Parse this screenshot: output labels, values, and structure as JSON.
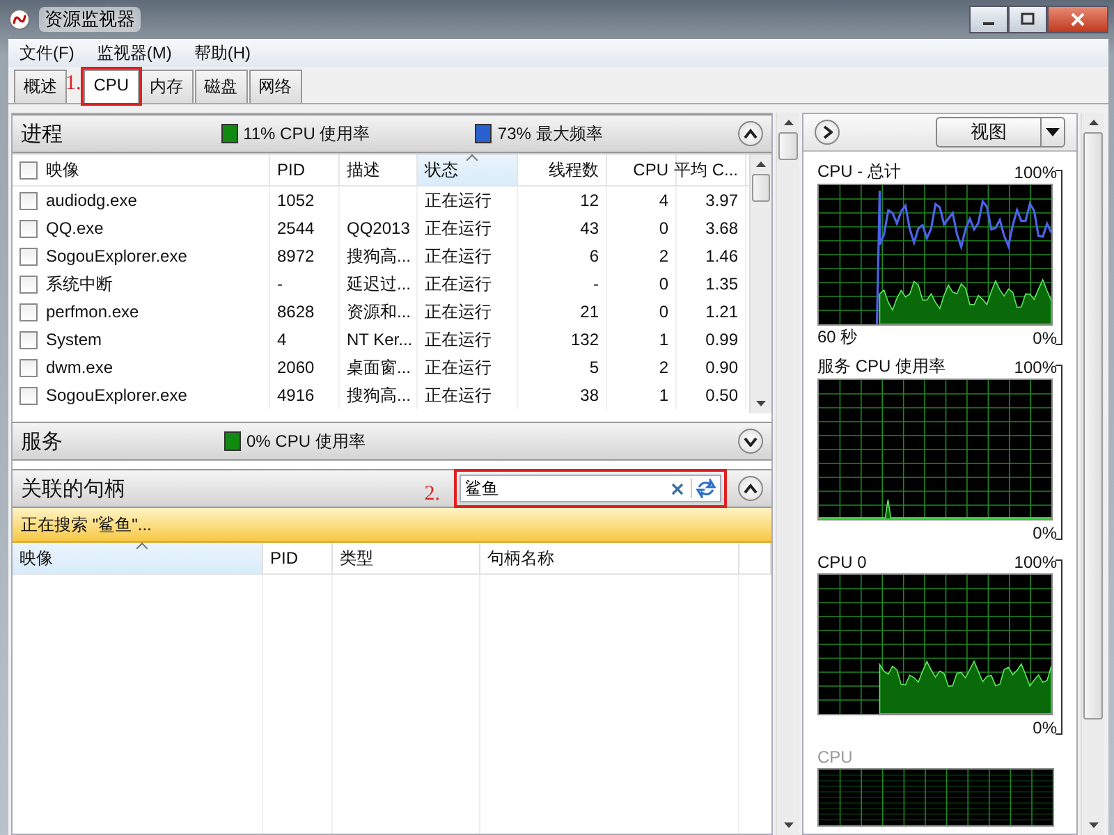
{
  "window": {
    "title": "资源监视器"
  },
  "menu": [
    "文件(F)",
    "监视器(M)",
    "帮助(H)"
  ],
  "tabs": [
    {
      "label": "概述",
      "selected": false,
      "marked": false
    },
    {
      "label": "CPU",
      "selected": true,
      "marked": true
    },
    {
      "label": "内存",
      "selected": false,
      "marked": false
    },
    {
      "label": "磁盘",
      "selected": false,
      "marked": false
    },
    {
      "label": "网络",
      "selected": false,
      "marked": false
    }
  ],
  "annotations": [
    "1.",
    "2."
  ],
  "processes": {
    "title": "进程",
    "expanded": true,
    "stats": [
      {
        "text": "11% CPU 使用率",
        "color": "#128a12"
      },
      {
        "text": "73% 最大频率",
        "color": "#2a5fd0"
      }
    ],
    "header_checked": false,
    "columns": [
      {
        "label": "映像",
        "sorted": false
      },
      {
        "label": "PID",
        "sorted": false
      },
      {
        "label": "描述",
        "sorted": false
      },
      {
        "label": "状态",
        "sorted": true
      },
      {
        "label": "线程数",
        "sorted": false
      },
      {
        "label": "CPU",
        "sorted": false
      },
      {
        "label": "平均 C...",
        "sorted": false
      }
    ],
    "rows": [
      {
        "checked": false,
        "cells": [
          "audiodg.exe",
          "1052",
          "",
          "正在运行",
          "12",
          "4",
          "3.97"
        ]
      },
      {
        "checked": false,
        "cells": [
          "QQ.exe",
          "2544",
          "QQ2013",
          "正在运行",
          "43",
          "0",
          "3.68"
        ]
      },
      {
        "checked": false,
        "cells": [
          "SogouExplorer.exe",
          "8972",
          "搜狗高...",
          "正在运行",
          "6",
          "2",
          "1.46"
        ]
      },
      {
        "checked": false,
        "cells": [
          "系统中断",
          "-",
          "延迟过...",
          "正在运行",
          "-",
          "0",
          "1.35"
        ]
      },
      {
        "checked": false,
        "cells": [
          "perfmon.exe",
          "8628",
          "资源和...",
          "正在运行",
          "21",
          "0",
          "1.21"
        ]
      },
      {
        "checked": false,
        "cells": [
          "System",
          "4",
          "NT Ker...",
          "正在运行",
          "132",
          "1",
          "0.99"
        ]
      },
      {
        "checked": false,
        "cells": [
          "dwm.exe",
          "2060",
          "桌面窗...",
          "正在运行",
          "5",
          "2",
          "0.90"
        ]
      },
      {
        "checked": false,
        "cells": [
          "SogouExplorer.exe",
          "4916",
          "搜狗高...",
          "正在运行",
          "38",
          "1",
          "0.50"
        ]
      }
    ]
  },
  "services": {
    "title": "服务",
    "expanded": false,
    "stats": [
      {
        "text": "0% CPU 使用率",
        "color": "#128a12"
      }
    ]
  },
  "handles": {
    "title": "关联的句柄",
    "expanded": true,
    "search": {
      "value": "鲨鱼",
      "marked": true
    },
    "status": "正在搜索 \"鲨鱼\"...",
    "columns": [
      {
        "label": "映像",
        "sorted": true
      },
      {
        "label": "PID",
        "sorted": false
      },
      {
        "label": "类型",
        "sorted": false
      },
      {
        "label": "句柄名称",
        "sorted": false
      }
    ]
  },
  "graph_panel": {
    "view_button": "视图",
    "graphs": [
      {
        "kind": "total",
        "title": "CPU - 总计",
        "max": "100%",
        "time": "60 秒",
        "min": "0%"
      },
      {
        "kind": "service",
        "title": "服务 CPU 使用率",
        "max": "100%",
        "min": "0%"
      },
      {
        "kind": "core",
        "title": "CPU 0",
        "max": "100%",
        "min": "0%"
      },
      {
        "kind": "partial",
        "title": "CPU"
      }
    ]
  }
}
